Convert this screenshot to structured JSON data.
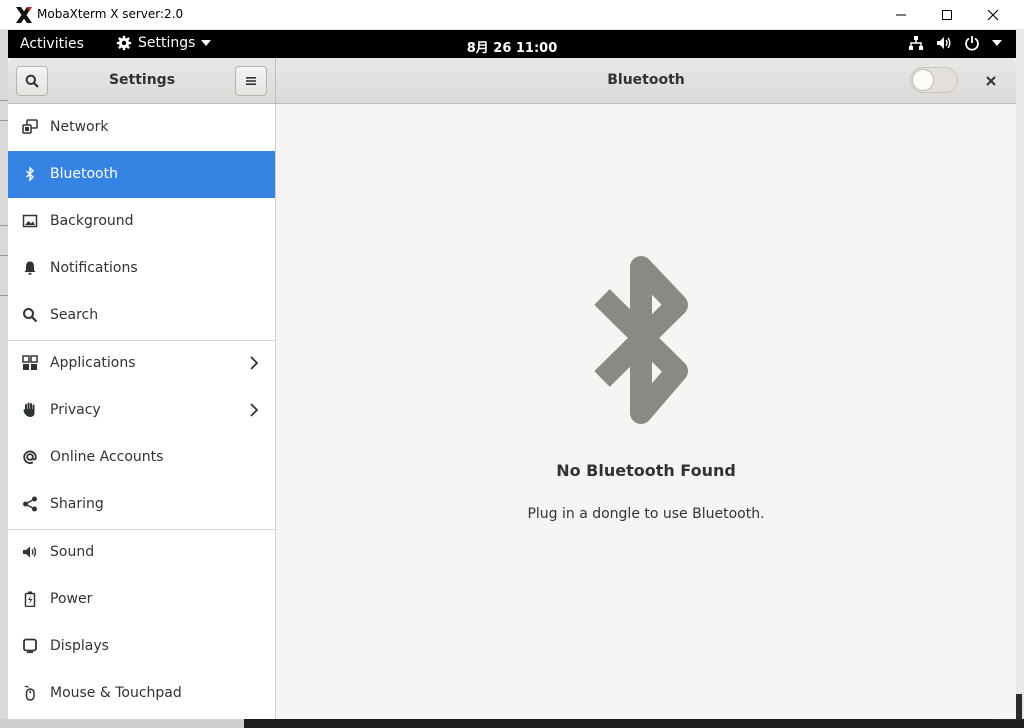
{
  "window": {
    "title": "MobaXterm X server:2.0",
    "logo_icon": "x-logo-icon"
  },
  "topbar": {
    "activities": "Activities",
    "app_menu": "Settings",
    "clock": "8月 26  11:00",
    "tray_icons": [
      "network-icon",
      "volume-icon",
      "power-icon",
      "chevron-down-icon"
    ]
  },
  "header": {
    "sidebar_title": "Settings",
    "panel_title": "Bluetooth",
    "bluetooth_toggle": false
  },
  "sidebar": {
    "items": [
      {
        "label": "Network",
        "icon": "network-icon",
        "active": false,
        "has_chevron": false
      },
      {
        "label": "Bluetooth",
        "icon": "bluetooth-icon",
        "active": true,
        "has_chevron": false
      },
      {
        "label": "Background",
        "icon": "background-icon",
        "active": false,
        "has_chevron": false
      },
      {
        "label": "Notifications",
        "icon": "bell-icon",
        "active": false,
        "has_chevron": false
      },
      {
        "label": "Search",
        "icon": "search-icon",
        "active": false,
        "has_chevron": false
      },
      {
        "label": "Applications",
        "icon": "apps-grid-icon",
        "active": false,
        "has_chevron": true
      },
      {
        "label": "Privacy",
        "icon": "hand-icon",
        "active": false,
        "has_chevron": true
      },
      {
        "label": "Online Accounts",
        "icon": "at-icon",
        "active": false,
        "has_chevron": false
      },
      {
        "label": "Sharing",
        "icon": "share-icon",
        "active": false,
        "has_chevron": false
      },
      {
        "label": "Sound",
        "icon": "speaker-icon",
        "active": false,
        "has_chevron": false
      },
      {
        "label": "Power",
        "icon": "battery-icon",
        "active": false,
        "has_chevron": false
      },
      {
        "label": "Displays",
        "icon": "display-icon",
        "active": false,
        "has_chevron": false
      },
      {
        "label": "Mouse & Touchpad",
        "icon": "mouse-icon",
        "active": false,
        "has_chevron": false
      }
    ]
  },
  "main": {
    "empty_title": "No Bluetooth Found",
    "empty_subtitle": "Plug in a dongle to use Bluetooth."
  },
  "colors": {
    "accent": "#3584e4",
    "text": "#2e3436",
    "topbar": "#000000",
    "bluetooth_art": "#888a85"
  }
}
